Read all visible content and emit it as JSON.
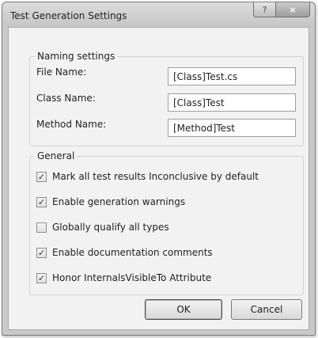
{
  "dialog": {
    "title": "Test Generation Settings",
    "help_icon": "?",
    "close_icon": "×"
  },
  "naming": {
    "legend": "Naming settings",
    "fields": [
      {
        "label": "File Name:",
        "value": "[Class]Test.cs"
      },
      {
        "label": "Class Name:",
        "value": "[Class]Test"
      },
      {
        "label": "Method Name:",
        "value": "[Method]Test"
      }
    ]
  },
  "general": {
    "legend": "General",
    "options": [
      {
        "label": "Mark all test results Inconclusive by default",
        "checked": true
      },
      {
        "label": "Enable generation warnings",
        "checked": true
      },
      {
        "label": "Globally qualify all types",
        "checked": false
      },
      {
        "label": "Enable documentation comments",
        "checked": true
      },
      {
        "label": "Honor InternalsVisibleTo Attribute",
        "checked": true
      }
    ]
  },
  "buttons": {
    "ok": "OK",
    "cancel": "Cancel"
  },
  "icons": {
    "check": "✓"
  }
}
